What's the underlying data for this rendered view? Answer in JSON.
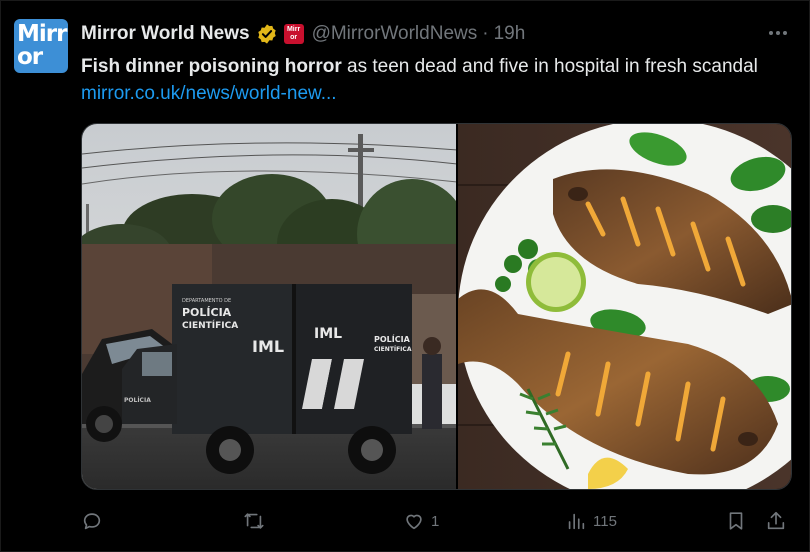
{
  "account": {
    "name": "Mirror World News",
    "handle": "@MirrorWorldNews",
    "separator": "·",
    "time": "19h",
    "avatar_text_top": "Mirr",
    "avatar_text_bottom": "or",
    "affiliate_badge_text": "Mirr or"
  },
  "tweet": {
    "headline_bold": "Fish dinner poisoning horror",
    "headline_rest": " as teen dead and five in hospital in fresh scandal ",
    "link_text": "mirror.co.uk/news/world-new..."
  },
  "media": {
    "left_image": {
      "truck_text_1": "DEPARTAMENTO DE",
      "truck_text_2": "POLÍCIA",
      "truck_text_3": "CIENTÍFICA",
      "truck_text_4": "IML",
      "truck_text_5": "IML",
      "truck_text_6": "POLÍCIA",
      "truck_text_7": "CIENTÍFICA",
      "truck_text_8": "POLÍCIA"
    }
  },
  "actions": {
    "reply_count": "",
    "retweet_count": "",
    "like_count": "1",
    "views_count": "115"
  },
  "colors": {
    "background": "#000000",
    "text_primary": "#e7e9ea",
    "text_secondary": "#71767b",
    "link": "#1d9bf0",
    "verified_gold": "#e2b719",
    "avatar_blue": "#3d8fd6"
  }
}
